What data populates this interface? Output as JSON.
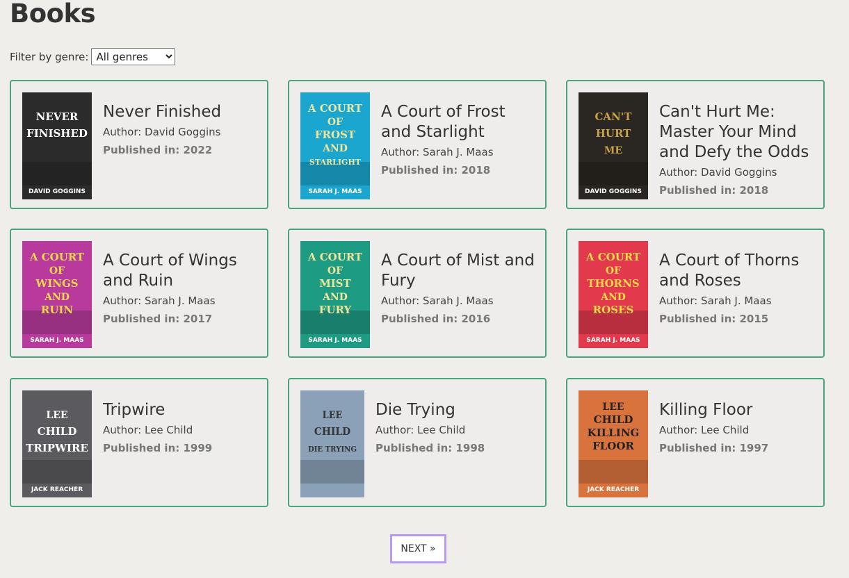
{
  "page": {
    "title": "Books"
  },
  "filter": {
    "label": "Filter by genre:",
    "selected": "All genres",
    "options": [
      "All genres"
    ]
  },
  "books": [
    {
      "title": "Never Finished",
      "author": "Author: David Goggins",
      "year_label": "Published in: 2022",
      "cover": {
        "bg": "#2b2b2b",
        "accent": "#ffffff",
        "lines": [
          "NEVER",
          "FINISHED"
        ],
        "footer": "DAVID GOGGINS"
      }
    },
    {
      "title": "A Court of Frost and Starlight",
      "author": "Author: Sarah J. Maas",
      "year_label": "Published in: 2018",
      "cover": {
        "bg": "#1aa6cf",
        "accent": "#f1e49b",
        "lines": [
          "A COURT",
          "OF",
          "FROST",
          "AND",
          "STARLIGHT"
        ],
        "footer": "SARAH J. MAAS"
      }
    },
    {
      "title": "Can't Hurt Me: Master Your Mind and Defy the Odds",
      "author": "Author: David Goggins",
      "year_label": "Published in: 2018",
      "cover": {
        "bg": "#2a2722",
        "accent": "#c8a24a",
        "lines": [
          "CAN'T",
          "HURT",
          "ME"
        ],
        "footer": "DAVID GOGGINS"
      }
    },
    {
      "title": "A Court of Wings and Ruin",
      "author": "Author: Sarah J. Maas",
      "year_label": "Published in: 2017",
      "cover": {
        "bg": "#b83a9c",
        "accent": "#f5d94a",
        "lines": [
          "A COURT",
          "OF",
          "WINGS",
          "AND",
          "RUIN"
        ],
        "footer": "SARAH J. MAAS"
      }
    },
    {
      "title": "A Court of Mist and Fury",
      "author": "Author: Sarah J. Maas",
      "year_label": "Published in: 2016",
      "cover": {
        "bg": "#1d9c83",
        "accent": "#f1e49b",
        "lines": [
          "A COURT",
          "OF",
          "MIST",
          "AND",
          "FURY"
        ],
        "footer": "SARAH J. MAAS"
      }
    },
    {
      "title": "A Court of Thorns and Roses",
      "author": "Author: Sarah J. Maas",
      "year_label": "Published in: 2015",
      "cover": {
        "bg": "#e2394c",
        "accent": "#f5d94a",
        "lines": [
          "A COURT",
          "OF",
          "THORNS",
          "AND",
          "ROSES"
        ],
        "footer": "SARAH J. MAAS"
      }
    },
    {
      "title": "Tripwire",
      "author": "Author: Lee Child",
      "year_label": "Published in: 1999",
      "cover": {
        "bg": "#5b5b5f",
        "accent": "#ffffff",
        "lines": [
          "LEE",
          "CHILD",
          "TRIPWIRE"
        ],
        "footer": "JACK REACHER"
      }
    },
    {
      "title": "Die Trying",
      "author": "Author: Lee Child",
      "year_label": "Published in: 1998",
      "cover": {
        "bg": "#8aa1b8",
        "accent": "#333333",
        "lines": [
          "LEE",
          "CHILD",
          "DIE TRYING"
        ],
        "footer": ""
      }
    },
    {
      "title": "Killing Floor",
      "author": "Author: Lee Child",
      "year_label": "Published in: 1997",
      "cover": {
        "bg": "#d9733e",
        "accent": "#222222",
        "lines": [
          "LEE",
          "CHILD",
          "KILLING",
          "FLOOR"
        ],
        "footer": "JACK REACHER"
      }
    }
  ],
  "pagination": {
    "next_label": "NEXT »"
  }
}
